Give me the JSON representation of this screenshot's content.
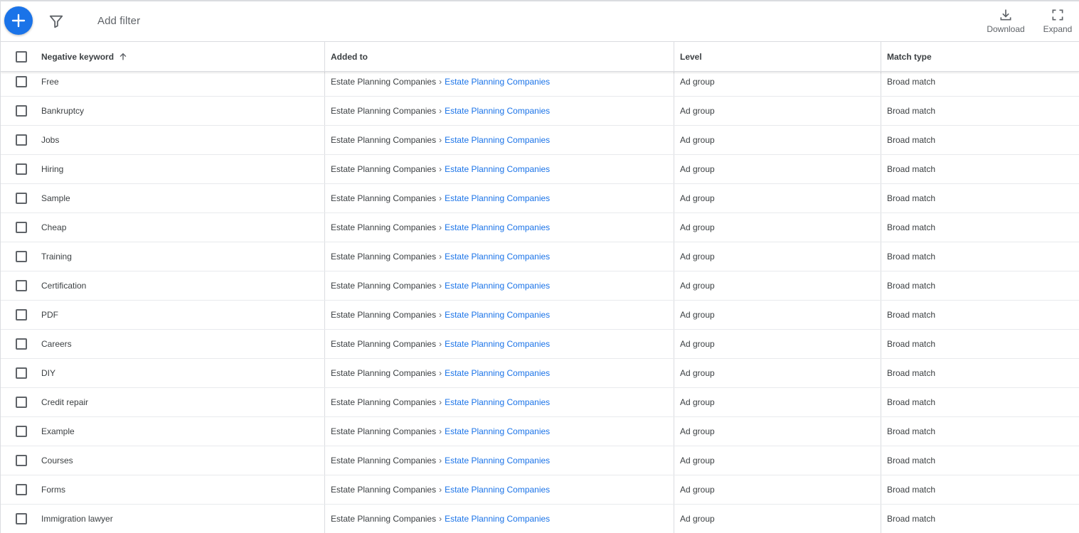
{
  "toolbar": {
    "add_filter_label": "Add filter",
    "download_label": "Download",
    "expand_label": "Expand"
  },
  "table": {
    "columns": {
      "keyword": "Negative keyword",
      "added_to": "Added to",
      "level": "Level",
      "match_type": "Match type"
    },
    "sort": "ascending",
    "rows": [
      {
        "keyword": "Free",
        "campaign": "Estate Planning Companies",
        "ad_group": "Estate Planning Companies",
        "level": "Ad group",
        "match": "Broad match"
      },
      {
        "keyword": "Bankruptcy",
        "campaign": "Estate Planning Companies",
        "ad_group": "Estate Planning Companies",
        "level": "Ad group",
        "match": "Broad match"
      },
      {
        "keyword": "Jobs",
        "campaign": "Estate Planning Companies",
        "ad_group": "Estate Planning Companies",
        "level": "Ad group",
        "match": "Broad match"
      },
      {
        "keyword": "Hiring",
        "campaign": "Estate Planning Companies",
        "ad_group": "Estate Planning Companies",
        "level": "Ad group",
        "match": "Broad match"
      },
      {
        "keyword": "Sample",
        "campaign": "Estate Planning Companies",
        "ad_group": "Estate Planning Companies",
        "level": "Ad group",
        "match": "Broad match"
      },
      {
        "keyword": "Cheap",
        "campaign": "Estate Planning Companies",
        "ad_group": "Estate Planning Companies",
        "level": "Ad group",
        "match": "Broad match"
      },
      {
        "keyword": "Training",
        "campaign": "Estate Planning Companies",
        "ad_group": "Estate Planning Companies",
        "level": "Ad group",
        "match": "Broad match"
      },
      {
        "keyword": "Certification",
        "campaign": "Estate Planning Companies",
        "ad_group": "Estate Planning Companies",
        "level": "Ad group",
        "match": "Broad match"
      },
      {
        "keyword": "PDF",
        "campaign": "Estate Planning Companies",
        "ad_group": "Estate Planning Companies",
        "level": "Ad group",
        "match": "Broad match"
      },
      {
        "keyword": "Careers",
        "campaign": "Estate Planning Companies",
        "ad_group": "Estate Planning Companies",
        "level": "Ad group",
        "match": "Broad match"
      },
      {
        "keyword": "DIY",
        "campaign": "Estate Planning Companies",
        "ad_group": "Estate Planning Companies",
        "level": "Ad group",
        "match": "Broad match"
      },
      {
        "keyword": "Credit repair",
        "campaign": "Estate Planning Companies",
        "ad_group": "Estate Planning Companies",
        "level": "Ad group",
        "match": "Broad match"
      },
      {
        "keyword": "Example",
        "campaign": "Estate Planning Companies",
        "ad_group": "Estate Planning Companies",
        "level": "Ad group",
        "match": "Broad match"
      },
      {
        "keyword": "Courses",
        "campaign": "Estate Planning Companies",
        "ad_group": "Estate Planning Companies",
        "level": "Ad group",
        "match": "Broad match"
      },
      {
        "keyword": "Forms",
        "campaign": "Estate Planning Companies",
        "ad_group": "Estate Planning Companies",
        "level": "Ad group",
        "match": "Broad match"
      },
      {
        "keyword": "Immigration lawyer",
        "campaign": "Estate Planning Companies",
        "ad_group": "Estate Planning Companies",
        "level": "Ad group",
        "match": "Broad match"
      }
    ]
  },
  "colors": {
    "accent": "#1a73e8",
    "text": "#3c4043",
    "muted": "#5f6368",
    "divider": "#dadce0"
  },
  "icons": {
    "fab": "plus-icon",
    "filter": "filter-icon",
    "download": "download-icon",
    "expand": "expand-icon",
    "sort": "arrow-up-icon"
  }
}
